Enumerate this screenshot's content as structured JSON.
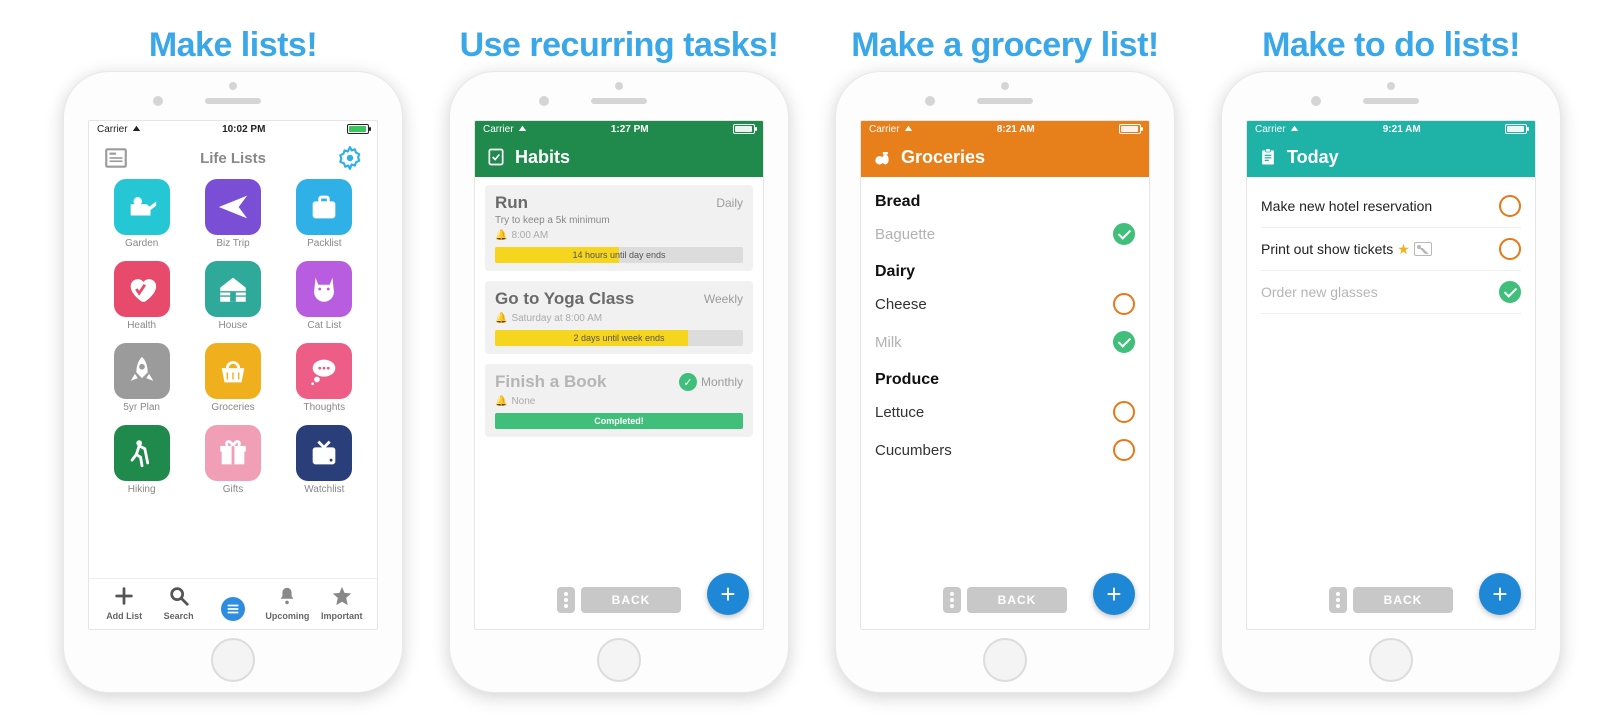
{
  "headings": {
    "panel1": "Make lists!",
    "panel2": "Use recurring tasks!",
    "panel3": "Make a grocery list!",
    "panel4": "Make to do lists!"
  },
  "status": {
    "carrier": "Carrier",
    "time1": "10:02 PM",
    "time2": "1:27 PM",
    "time3": "8:21 AM",
    "time4": "9:21 AM"
  },
  "screen1": {
    "title": "Life Lists",
    "bottom": {
      "add": "Add List",
      "search": "Search",
      "upcoming": "Upcoming",
      "important": "Important"
    },
    "tiles": [
      {
        "label": "Garden",
        "color": "#25c7d4",
        "icon": "watering"
      },
      {
        "label": "Biz Trip",
        "color": "#7a4fd6",
        "icon": "plane"
      },
      {
        "label": "Packlist",
        "color": "#2fb0e6",
        "icon": "suitcase"
      },
      {
        "label": "Health",
        "color": "#e84a6b",
        "icon": "heart"
      },
      {
        "label": "House",
        "color": "#2fa99a",
        "icon": "house"
      },
      {
        "label": "Cat List",
        "color": "#b85ce0",
        "icon": "cat"
      },
      {
        "label": "5yr Plan",
        "color": "#9b9b9b",
        "icon": "rocket"
      },
      {
        "label": "Groceries",
        "color": "#f0b01e",
        "icon": "basket"
      },
      {
        "label": "Thoughts",
        "color": "#ee5d86",
        "icon": "thought"
      },
      {
        "label": "Hiking",
        "color": "#1f8a4c",
        "icon": "hiker"
      },
      {
        "label": "Gifts",
        "color": "#f19fb7",
        "icon": "gift"
      },
      {
        "label": "Watchlist",
        "color": "#2a3e7a",
        "icon": "tv"
      }
    ]
  },
  "screen2": {
    "header_color": "#1f8a4c",
    "title": "Habits",
    "cards": [
      {
        "title": "Run",
        "freq": "Daily",
        "sub": "Try to keep a 5k minimum",
        "alarm": "8:00 AM",
        "progress_width": 50,
        "progress_label": "14 hours until day ends",
        "done": false
      },
      {
        "title": "Go to Yoga Class",
        "freq": "Weekly",
        "sub": "",
        "alarm": "Saturday at 8:00 AM",
        "progress_width": 78,
        "progress_label": "2 days until week ends",
        "done": false
      },
      {
        "title": "Finish a Book",
        "freq": "Monthly",
        "sub": "",
        "alarm": "None",
        "progress_width": 100,
        "progress_label": "Completed!",
        "done": true
      }
    ],
    "back_label": "BACK"
  },
  "screen3": {
    "header_color": "#e77f1b",
    "title": "Groceries",
    "sections": [
      {
        "header": "Bread",
        "items": [
          {
            "text": "Baguette",
            "done": true
          }
        ]
      },
      {
        "header": "Dairy",
        "items": [
          {
            "text": "Cheese",
            "done": false
          },
          {
            "text": "Milk",
            "done": true
          }
        ]
      },
      {
        "header": "Produce",
        "items": [
          {
            "text": "Lettuce",
            "done": false
          },
          {
            "text": "Cucumbers",
            "done": false
          }
        ]
      }
    ],
    "back_label": "BACK"
  },
  "screen4": {
    "header_color": "#1fb2a6",
    "title": "Today",
    "items": [
      {
        "text": "Make new hotel reservation",
        "done": false,
        "star": false,
        "pic": false
      },
      {
        "text": "Print out show tickets",
        "done": false,
        "star": true,
        "pic": true
      },
      {
        "text": "Order new glasses",
        "done": true,
        "star": false,
        "pic": false
      }
    ],
    "back_label": "BACK"
  }
}
